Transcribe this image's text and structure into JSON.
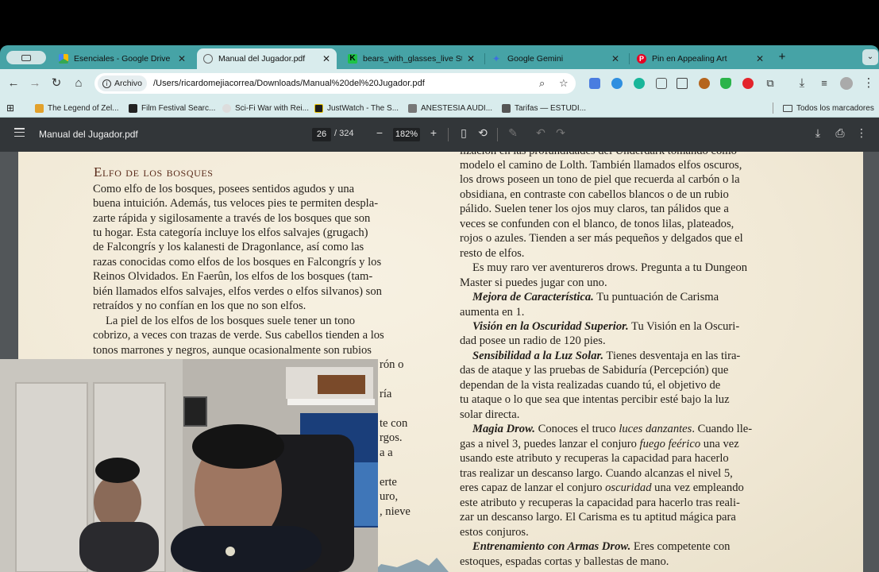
{
  "browser": {
    "tabs": [
      {
        "label": "Esenciales - Google Drive",
        "active": false
      },
      {
        "label": "Manual del Jugador.pdf",
        "active": true
      },
      {
        "label": "bears_with_glasses_live Stre",
        "active": false
      },
      {
        "label": "Google Gemini",
        "active": false
      },
      {
        "label": "Pin en Appealing Art",
        "active": false
      }
    ],
    "new_tab": "+",
    "address": {
      "chip": "Archivo",
      "url": "/Users/ricardomejiacorrea/Downloads/Manual%20del%20Jugador.pdf"
    },
    "bookmarks": [
      "The Legend of Zel...",
      "Film Festival Searc...",
      "Sci-Fi War with Rei...",
      "JustWatch - The S...",
      "ANESTESIA AUDI...",
      "Tarifas — ESTUDI..."
    ],
    "all_bookmarks": "Todos los marcadores"
  },
  "pdf_toolbar": {
    "title": "Manual del Jugador.pdf",
    "page_current": "26",
    "page_total": "/ 324",
    "zoom": "182%"
  },
  "document": {
    "left": {
      "heading": "Elfo de los bosques",
      "lines": [
        "Como elfo de los bosques, posees sentidos agudos y una",
        "buena intuición. Además, tus veloces pies te permiten despla-",
        "zarte rápida y sigilosamente a través de los bosques que son",
        "tu hogar. Esta categoría incluye los elfos salvajes (grugach)",
        "de Falcongrís y los kalanesti de Dragonlance, así como las",
        "razas conocidas como elfos de los bosques en Falcongrís y los",
        "Reinos Olvidados. En Faerûn, los elfos de los bosques (tam-",
        "bién llamados elfos salvajes, elfos verdes o elfos silvanos) son",
        "retraídos y no confían en los que no son elfos.",
        "La piel de los elfos de los bosques suele tener un tono",
        "cobrizo, a veces con trazas de verde. Sus cabellos tienden a los",
        "tonos marrones y negros, aunque ocasionalmente son rubios"
      ],
      "fragments": [
        "rón o",
        "ría",
        "te con",
        "rgos.",
        "a a",
        "erte",
        "uro,",
        ", nieve"
      ]
    },
    "right": {
      "top_cut": "lización en las profundidades del Underdark tomando como",
      "p1": [
        "modelo el camino de Lolth. También llamados elfos oscuros,",
        "los drows poseen un tono de piel que recuerda al carbón o la",
        "obsidiana, en contraste con cabellos blancos o de un rubio",
        "pálido. Suelen tener los ojos muy claros, tan pálidos que a",
        "veces se confunden con el blanco, de tonos lilas, plateados,",
        "rojos o azules. Tienden a ser más pequeños y delgados que el",
        "resto de elfos."
      ],
      "p2": [
        "Es muy raro ver aventureros drows. Pregunta a tu Dungeon",
        "Master si puedes jugar con uno."
      ],
      "mejora_title": "Mejora de Característica.",
      "mejora_text": " Tu puntuación de Carisma",
      "mejora_line2": "aumenta en 1.",
      "vision_title": "Visión en la Oscuridad Superior.",
      "vision_text": " Tu Visión en la Oscuri-",
      "vision_line2": "dad posee un radio de 120 pies.",
      "sens_title": "Sensibilidad a la Luz Solar.",
      "sens_text": " Tienes desventaja en las tira-",
      "sens_lines": [
        "das de ataque y las pruebas de Sabiduría (Percepción) que",
        "dependan de la vista realizadas cuando tú, el objetivo de",
        "tu ataque o lo que sea que intentas percibir esté bajo la luz",
        "solar directa."
      ],
      "magia_title": "Magia Drow.",
      "magia_text_a": " Conoces el truco ",
      "magia_it1": "luces danzantes",
      "magia_text_b": ". Cuando lle-",
      "magia_l2a": "gas a nivel 3, puedes lanzar el conjuro ",
      "magia_it2": "fuego feérico",
      "magia_l2b": " una vez",
      "magia_l3": "usando este atributo y recuperas la capacidad para hacerlo",
      "magia_l4": "tras realizar un descanso largo. Cuando alcanzas el nivel 5,",
      "magia_l5a": "eres capaz de lanzar el conjuro ",
      "magia_it3": "oscuridad",
      "magia_l5b": " una vez empleando",
      "magia_l6": "este atributo y recuperas la capacidad para hacerlo tras reali-",
      "magia_l7": "zar un descanso largo. El Carisma es tu aptitud mágica para",
      "magia_l8": "estos conjuros.",
      "entren_title": "Entrenamiento con Armas Drow.",
      "entren_text": " Eres competente con",
      "entren_l2": "estoques, espadas cortas y ballestas de mano."
    }
  },
  "colors": {
    "tab_strip": "#46a3a6",
    "toolbar": "#d9eced",
    "pdf_toolbar": "#323639",
    "page": "#f1ead8",
    "heading": "#5a2c1c"
  }
}
